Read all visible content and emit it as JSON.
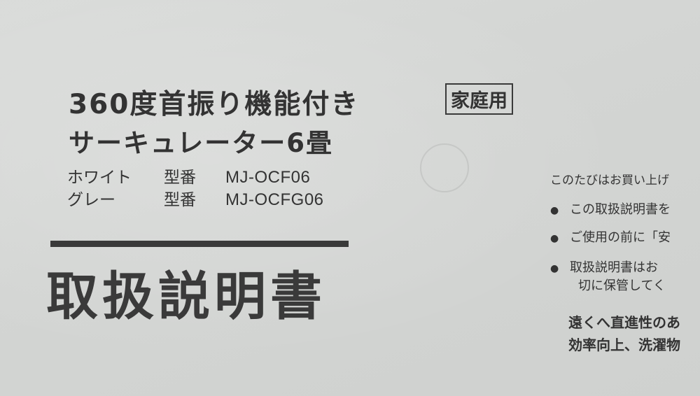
{
  "product": {
    "title_line1": "360度首振り機能付き",
    "title_line2": "サーキュレーター6畳",
    "badge": "家庭用"
  },
  "models": [
    {
      "color": "ホワイト",
      "label": "型番",
      "number": "MJ-OCF06"
    },
    {
      "color": "グレー",
      "label": "型番",
      "number": "MJ-OCFG06"
    }
  ],
  "manual_title": "取扱説明書",
  "right_column": {
    "intro": "このたびはお買い上げ",
    "bullets": [
      "この取扱説明書を",
      "ご使用の前に「安",
      "取扱説明書はお"
    ],
    "bullet3_continuation": "切に保管してく",
    "bold_lines": [
      "遠くへ直進性のあ",
      "効率向上、洗濯物"
    ]
  }
}
